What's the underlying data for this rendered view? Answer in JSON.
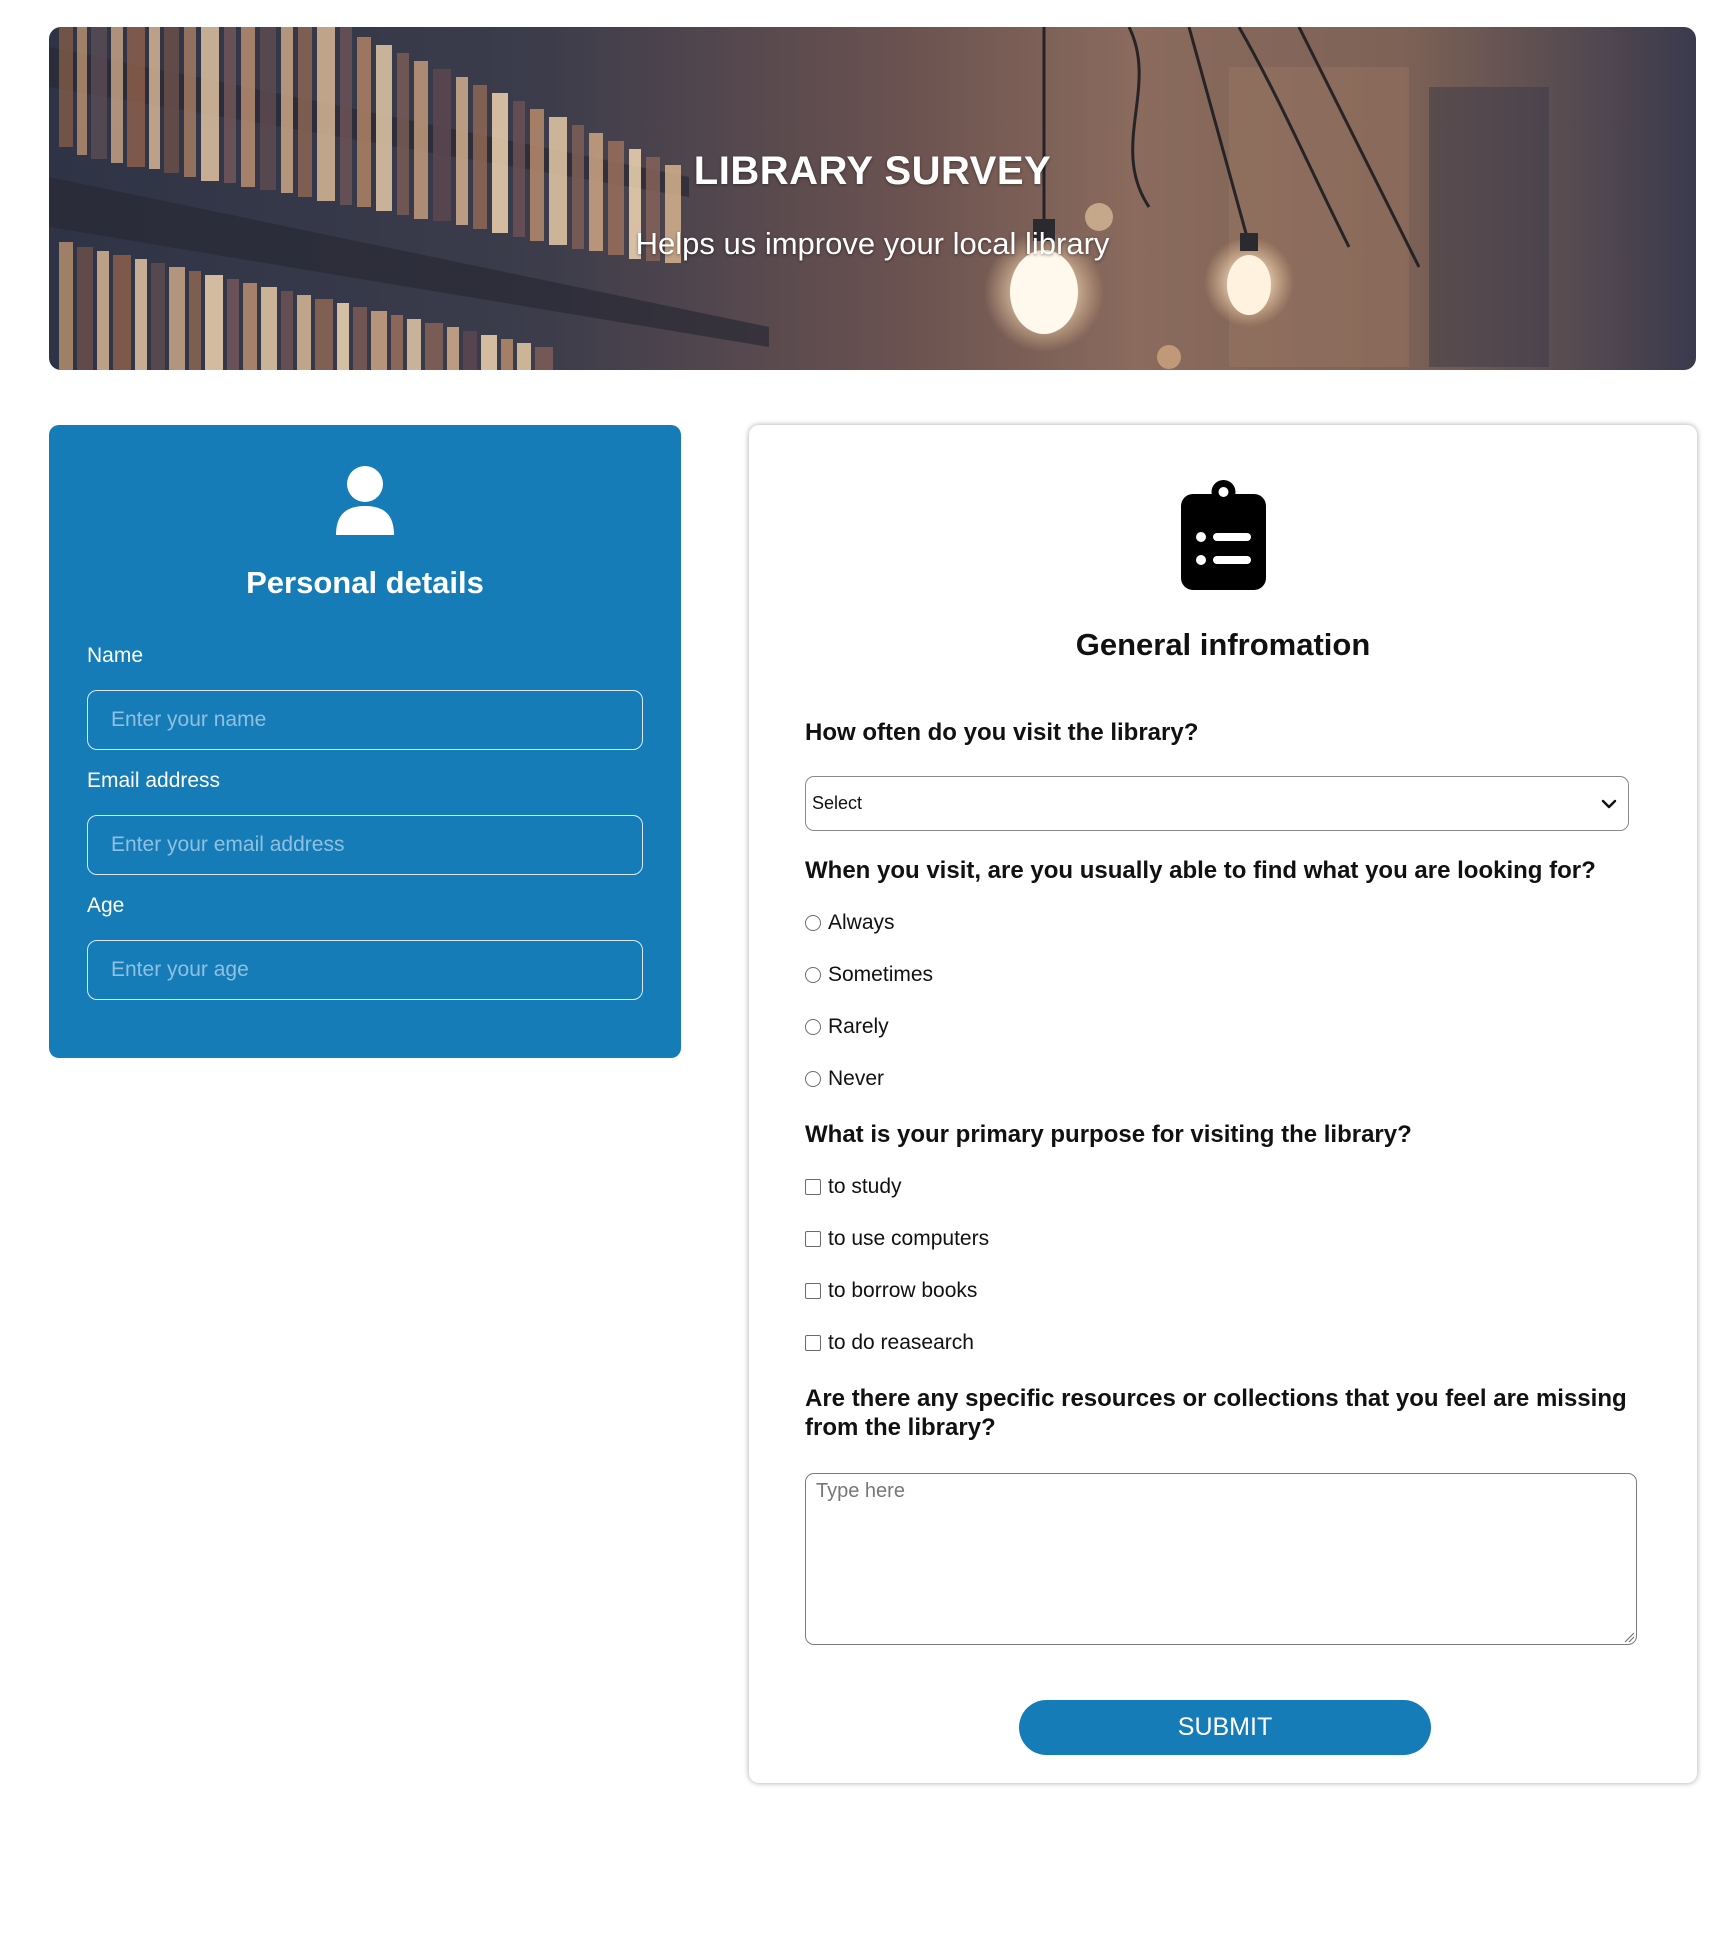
{
  "hero": {
    "title": "LIBRARY SURVEY",
    "subtitle": "Helps us improve your local library"
  },
  "personal": {
    "icon": "user-icon",
    "title": "Personal details",
    "fields": [
      {
        "label": "Name",
        "placeholder": "Enter your name"
      },
      {
        "label": "Email address",
        "placeholder": "Enter your email address"
      },
      {
        "label": "Age",
        "placeholder": "Enter your age"
      }
    ]
  },
  "general": {
    "icon": "clipboard-list-icon",
    "title": "General infromation",
    "q1": {
      "question": "How often do you visit the library?",
      "selected": "Select"
    },
    "q2": {
      "question": "When you visit, are you usually able to find what you are looking for?",
      "options": [
        "Always",
        "Sometimes",
        "Rarely",
        "Never"
      ]
    },
    "q3": {
      "question": "What is your primary purpose for visiting the library?",
      "options": [
        "to study",
        "to use computers",
        "to borrow books",
        "to do reasearch"
      ]
    },
    "q4": {
      "question": "Are there any specific resources or collections that you feel are missing from the library?",
      "placeholder": "Type here"
    },
    "submit_label": "SUBMIT"
  },
  "colors": {
    "accent": "#157cb8",
    "card_text": "#ffffff",
    "question_text": "#111111"
  }
}
